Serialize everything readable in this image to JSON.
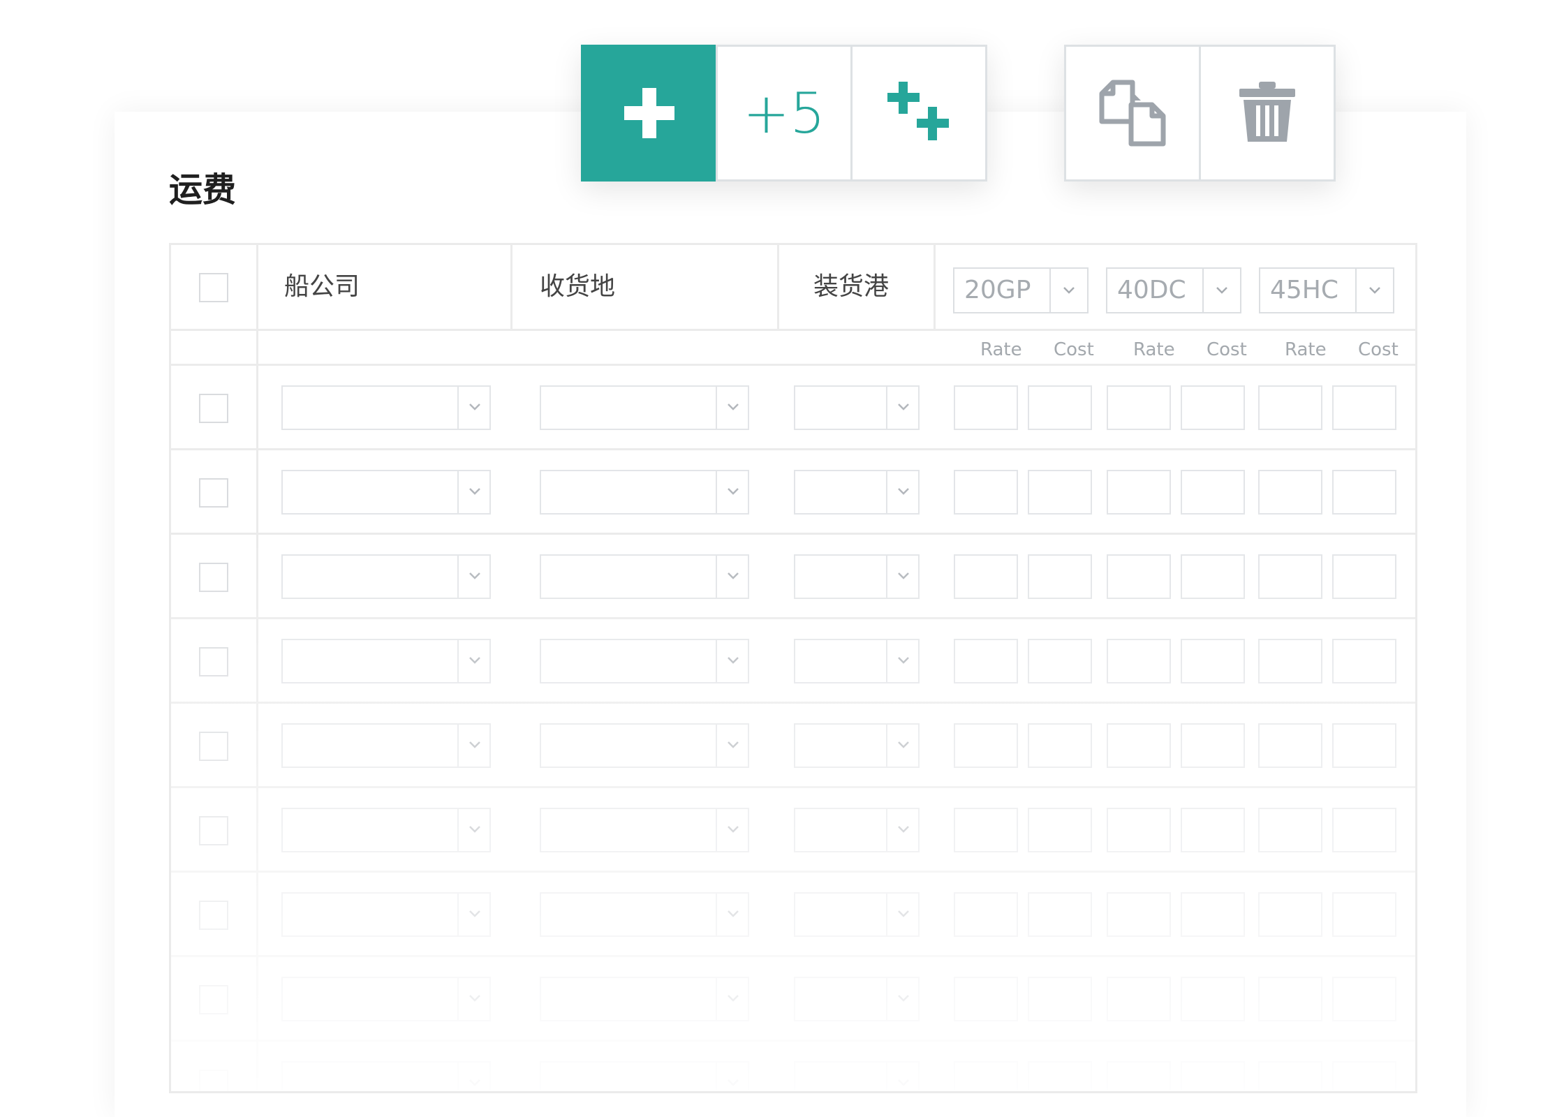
{
  "section": {
    "title": "运费"
  },
  "toolbar": {
    "add_icon": "plus-icon",
    "add_five_label": "+5",
    "add_multiple_icon": "double-plus-icon",
    "copy_icon": "copy-icon",
    "delete_icon": "trash-icon",
    "accent_color": "#26a69a"
  },
  "table": {
    "columns": [
      "船公司",
      "收货地",
      "装货港"
    ],
    "containers": [
      {
        "label": "20GP",
        "sub": [
          "Rate",
          "Cost"
        ]
      },
      {
        "label": "40DC",
        "sub": [
          "Rate",
          "Cost"
        ]
      },
      {
        "label": "45HC",
        "sub": [
          "Rate",
          "Cost"
        ]
      }
    ],
    "row_count": 9
  }
}
